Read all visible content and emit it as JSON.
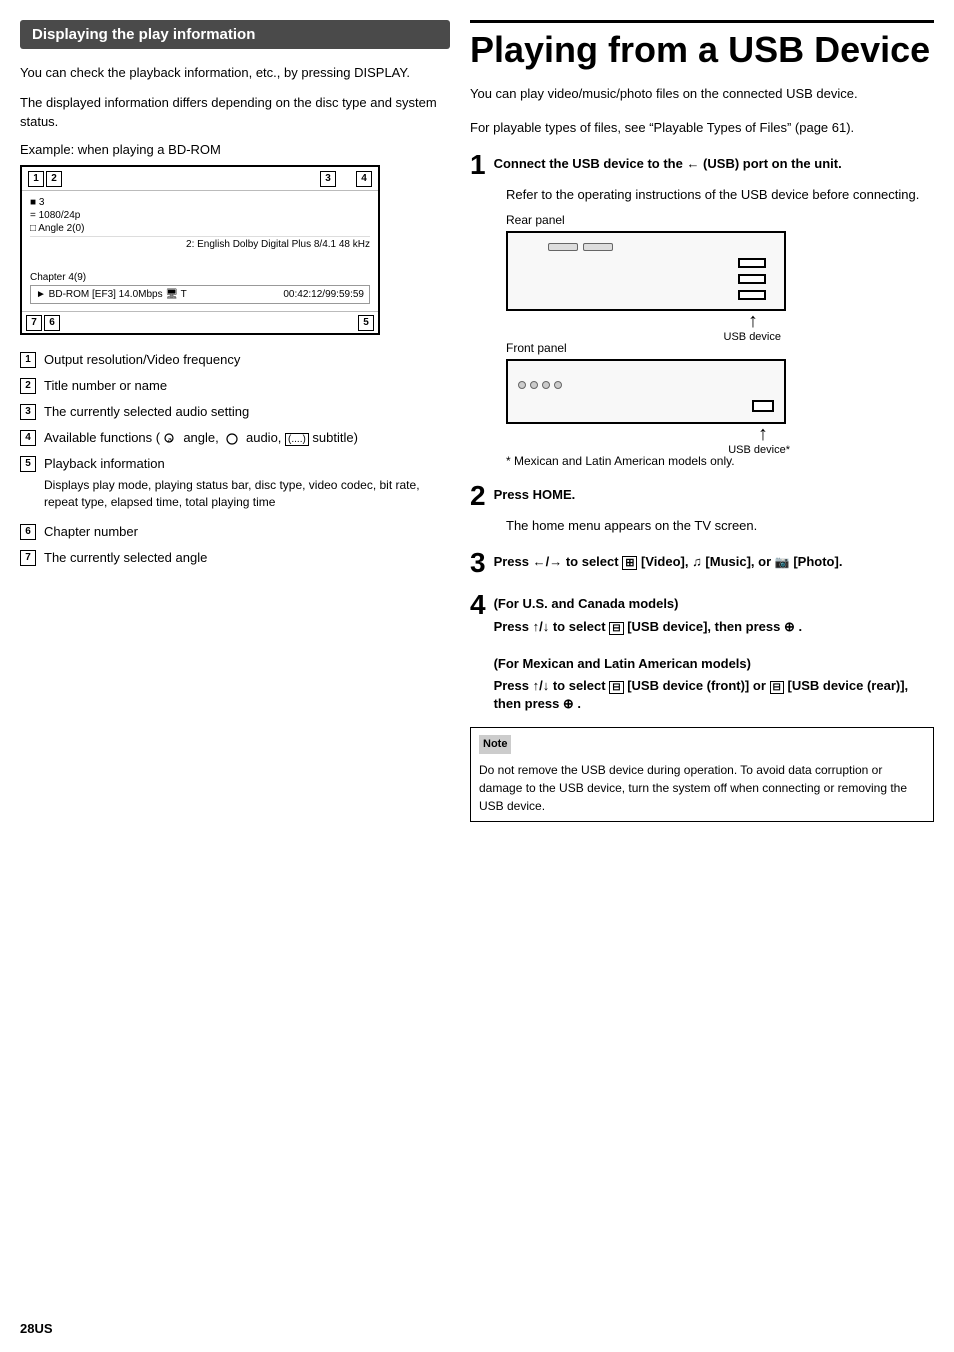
{
  "left": {
    "section_title": "Displaying the play information",
    "intro": [
      "You can check the playback information, etc., by pressing DISPLAY.",
      "The displayed information differs depending on the disc type and system status."
    ],
    "example_label": "Example: when playing a BD-ROM",
    "diagram": {
      "numbers_top": [
        "1",
        "2",
        "3",
        "4"
      ],
      "numbers_bottom": [
        "7",
        "6",
        "5"
      ],
      "lines": [
        "■ 3",
        "= 1080/24p",
        "□ Angle  2(0)",
        "2: English  Dolby Digital Plus  8/4.1 48 kHz",
        "Chapter 4(9)",
        "► BD-ROM [...]  14.0Mbps  🖥 T",
        "00:42:12/99:59:59"
      ]
    },
    "items": [
      {
        "num": "1",
        "text": "Output resolution/Video frequency",
        "sub": ""
      },
      {
        "num": "2",
        "text": "Title number or name",
        "sub": ""
      },
      {
        "num": "3",
        "text": "The currently selected audio setting",
        "sub": ""
      },
      {
        "num": "4",
        "text": "Available functions (👤 angle, ○○ audio, (....) subtitle)",
        "sub": ""
      },
      {
        "num": "5",
        "text": "Playback information",
        "sub": "Displays play mode, playing status bar, disc type, video codec, bit rate, repeat type, elapsed time, total playing time"
      },
      {
        "num": "6",
        "text": "Chapter number",
        "sub": ""
      },
      {
        "num": "7",
        "text": "The currently selected angle",
        "sub": ""
      }
    ]
  },
  "right": {
    "title": "Playing from a USB Device",
    "intro": [
      "You can play video/music/photo files on the connected USB device.",
      "For playable types of files, see “Playable Types of Files” (page 61)."
    ],
    "steps": [
      {
        "number": "1",
        "title": "Connect the USB device to the ←→ (USB) port on the unit.",
        "body": "Refer to the operating instructions of the USB device before connecting.",
        "panels": [
          {
            "label": "Rear panel",
            "type": "rear"
          },
          {
            "label": "Front panel",
            "type": "front"
          }
        ],
        "usb_device_label": "USB device",
        "usb_device_front_label": "USB device*",
        "asterisk_note": "*  Mexican and Latin American models only."
      },
      {
        "number": "2",
        "title": "Press HOME.",
        "body": "The home menu appears on the TV screen."
      },
      {
        "number": "3",
        "title": "Press ←/→ to select ⊡ [Video], ♫ [Music], or 📷 [Photo].",
        "body": ""
      },
      {
        "number": "4",
        "title_bold": "(For U.S. and Canada models)",
        "title": "Press ↑/↓ to select ⊡ [USB device], then press ⊕ .",
        "title2_bold": "(For Mexican and Latin American models)",
        "title2": "Press ↑/↓ to select ⊡ [USB device (front)] or ⊡ [USB device (rear)], then press ⊕ .",
        "body": ""
      }
    ],
    "note": {
      "title": "Note",
      "bullets": [
        "Do not remove the USB device during operation. To avoid data corruption or damage to the USB device, turn the system off when connecting or removing the USB device."
      ]
    }
  },
  "page_number": "28US"
}
